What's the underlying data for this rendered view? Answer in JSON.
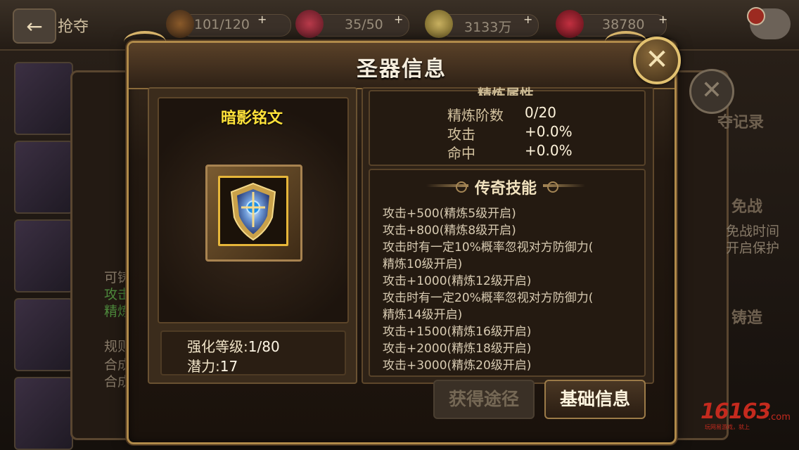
{
  "background": {
    "page_title": "抢夺",
    "resources": [
      {
        "name": "stamina",
        "icon": "fire-icon",
        "value": "101/120"
      },
      {
        "name": "energy",
        "icon": "heart-icon",
        "value": "35/50"
      },
      {
        "name": "gold",
        "icon": "coin-icon",
        "value": "3133万"
      },
      {
        "name": "gems",
        "icon": "gem-icon",
        "value": "38780"
      }
    ],
    "side_texts": [
      "可铸",
      "攻击",
      "精炼",
      "规则",
      "合成",
      "合成"
    ],
    "right_tags": [
      "夺记录",
      "免战",
      "免战时间",
      "开启保护",
      "铸造"
    ]
  },
  "modal": {
    "title": "圣器信息",
    "item": {
      "name": "暗影铭文",
      "icon": "shield-artifact-icon",
      "stats": [
        {
          "label": "强化等级:",
          "value": "1/80"
        },
        {
          "label": "潜力:",
          "value": "17"
        }
      ]
    },
    "refine": {
      "heading": "精炼属性",
      "rows": [
        {
          "label": "精炼阶数",
          "value": "0/20"
        },
        {
          "label": "攻击",
          "value": "+0.0%"
        },
        {
          "label": "命中",
          "value": "+0.0%"
        }
      ]
    },
    "legend": {
      "title": "传奇技能",
      "lines": [
        "攻击+500(精炼5级开启)",
        "攻击+800(精炼8级开启)",
        "攻击时有一定10%概率忽视对方防御力(",
        "精炼10级开启)",
        "攻击+1000(精炼12级开启)",
        "攻击时有一定20%概率忽视对方防御力(",
        "精炼14级开启)",
        "攻击+1500(精炼16级开启)",
        "攻击+2000(精炼18级开启)",
        "攻击+3000(精炼20级开启)"
      ]
    },
    "tabs": {
      "obtain": "获得途径",
      "basic": "基础信息"
    }
  },
  "watermark": {
    "big": "16163",
    "com": ".com",
    "small": "玩网易游戏，就上"
  }
}
